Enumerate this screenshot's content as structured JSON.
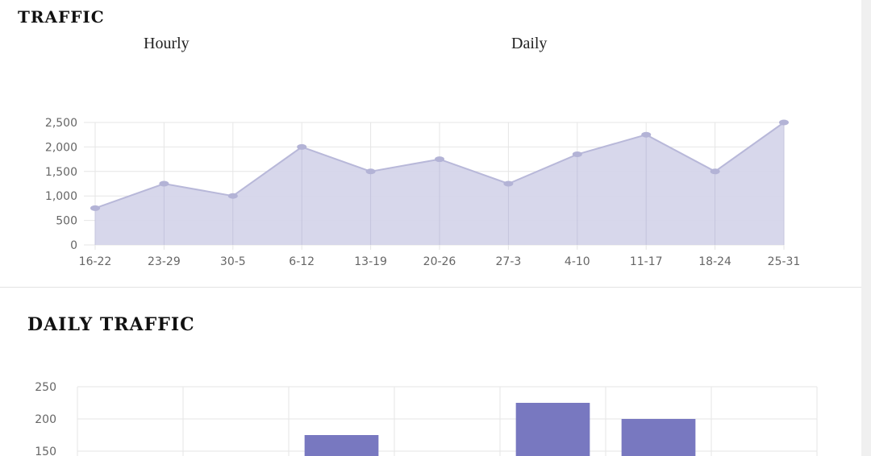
{
  "header": {
    "title": "TRAFFIC",
    "tabs": [
      {
        "label": "Hourly"
      },
      {
        "label": "Daily"
      }
    ]
  },
  "daily_section": {
    "title": "DAILY TRAFFIC"
  },
  "colors": {
    "area_fill": "#d5d5ea",
    "area_line": "#b8b8d9",
    "point": "#b3b3d6",
    "bar": "#7878c0",
    "grid": "#e6e6e6"
  },
  "chart_data": [
    {
      "type": "area",
      "categories": [
        "16-22",
        "23-29",
        "30-5",
        "6-12",
        "13-19",
        "20-26",
        "27-3",
        "4-10",
        "11-17",
        "18-24",
        "25-31"
      ],
      "series": [
        {
          "values": [
            750,
            1250,
            1000,
            2000,
            1500,
            1750,
            1250,
            1850,
            2250,
            1500,
            2500
          ]
        }
      ],
      "y_ticks": [
        "0",
        "500",
        "1,000",
        "1,500",
        "2,000",
        "2,500"
      ],
      "ylim": [
        0,
        2500
      ],
      "grid": true,
      "legend": "none"
    },
    {
      "type": "bar",
      "note_visible_portion": true,
      "categories": [
        "",
        "",
        "",
        "",
        "",
        "",
        ""
      ],
      "series": [
        {
          "values": [
            null,
            null,
            175,
            null,
            225,
            200,
            null
          ]
        }
      ],
      "y_ticks": [
        "150",
        "200",
        "250"
      ],
      "ylim": [
        0,
        250
      ],
      "grid": true,
      "legend": "none"
    }
  ]
}
